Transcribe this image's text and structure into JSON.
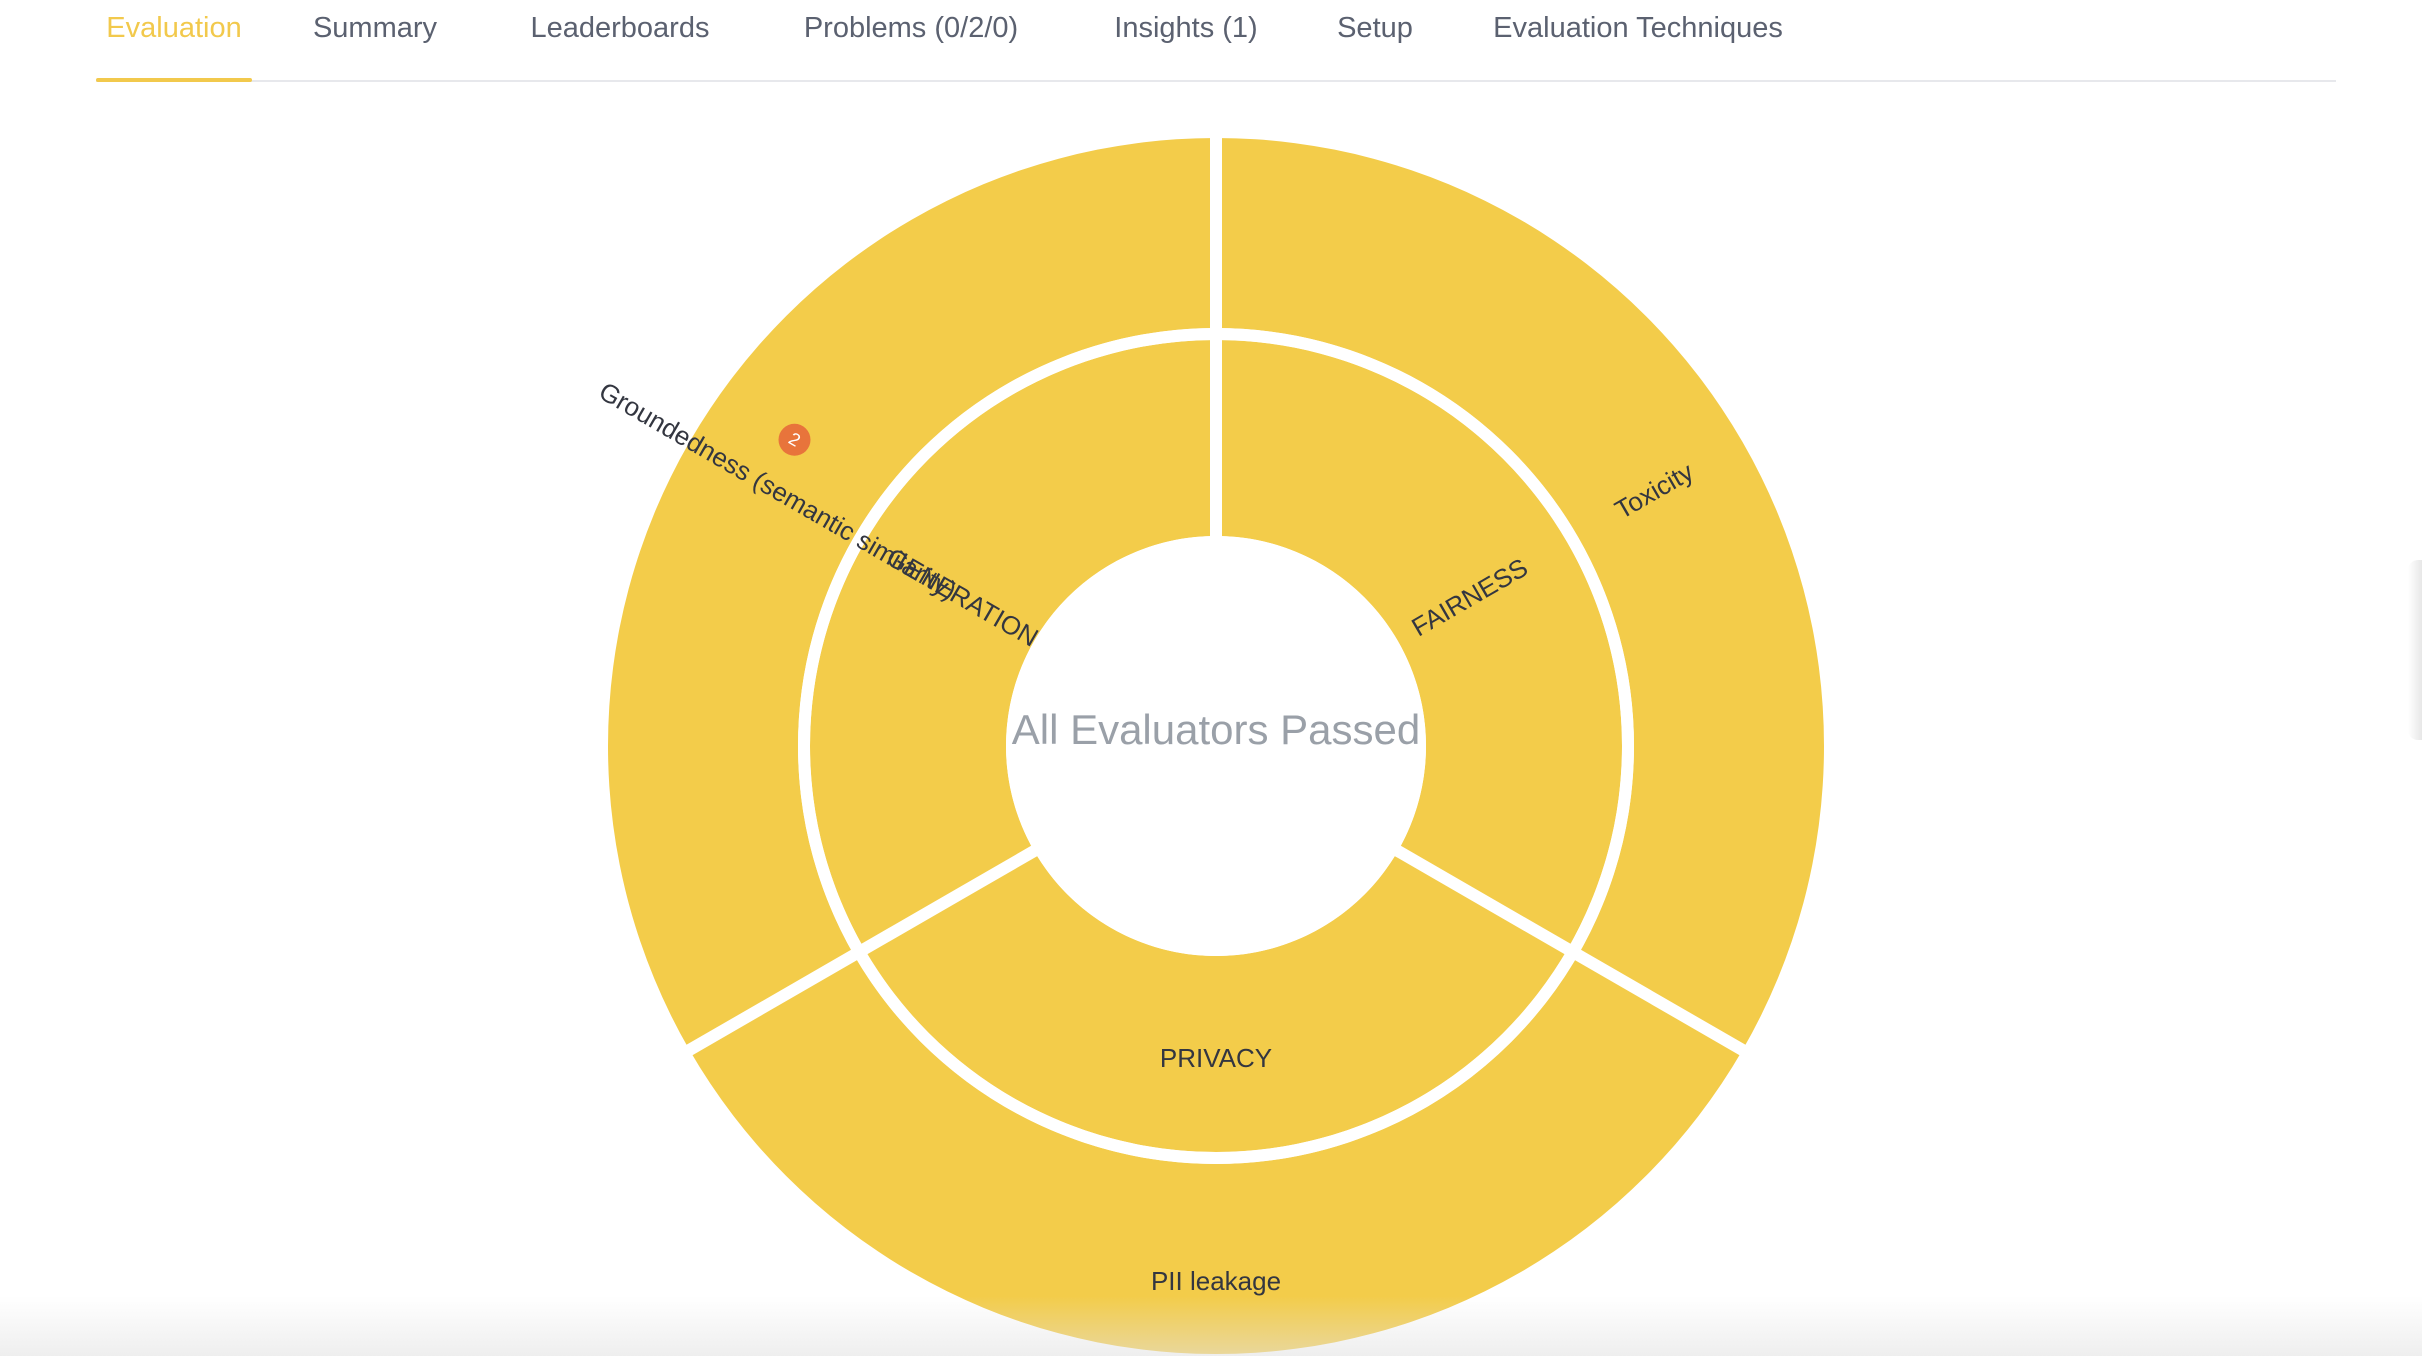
{
  "tabs": [
    {
      "label": "Evaluation",
      "active": true
    },
    {
      "label": "Summary"
    },
    {
      "label": "Leaderboards"
    },
    {
      "label": "Problems (0/2/0)"
    },
    {
      "label": "Insights (1)"
    },
    {
      "label": "Setup"
    },
    {
      "label": "Evaluation Techniques"
    }
  ],
  "colors": {
    "segment": "#f3cc4a",
    "accent": "#f2c94c",
    "badge": "#e8743b",
    "center_text": "#9aa0a8",
    "tab_text": "#5b6170"
  },
  "chart_data": {
    "type": "sunburst",
    "center_label": "All Evaluators Passed",
    "inner": [
      {
        "name": "FAIRNESS",
        "value": 1
      },
      {
        "name": "PRIVACY",
        "value": 1
      },
      {
        "name": "GENERATION",
        "value": 1
      }
    ],
    "outer": [
      {
        "name": "Toxicity",
        "parent": "FAIRNESS",
        "value": 1
      },
      {
        "name": "PII leakage",
        "parent": "PRIVACY",
        "value": 1
      },
      {
        "name": "Groundedness (semantic similarity)",
        "parent": "GENERATION",
        "value": 1,
        "badge": "2"
      }
    ]
  }
}
